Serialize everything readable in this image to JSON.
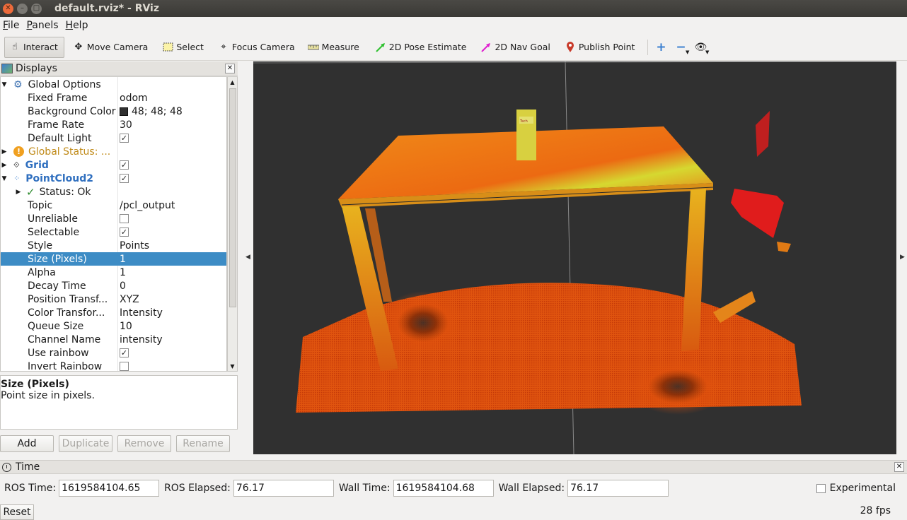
{
  "window": {
    "title": "default.rviz* - RViz"
  },
  "menu": [
    {
      "label": "File",
      "key": "F",
      "rest": "ile"
    },
    {
      "label": "Panels",
      "key": "P",
      "rest": "anels"
    },
    {
      "label": "Help",
      "key": "H",
      "rest": "elp"
    }
  ],
  "toolbar": {
    "interact": "Interact",
    "move_camera": "Move Camera",
    "select": "Select",
    "focus_camera": "Focus Camera",
    "measure": "Measure",
    "pose_estimate": "2D Pose Estimate",
    "nav_goal": "2D Nav Goal",
    "publish_point": "Publish Point"
  },
  "displays": {
    "title": "Displays",
    "rows": [
      {
        "name": "Global Options",
        "value": ""
      },
      {
        "name": "Fixed Frame",
        "value": "odom"
      },
      {
        "name": "Background Color",
        "value": "48; 48; 48"
      },
      {
        "name": "Frame Rate",
        "value": "30"
      },
      {
        "name": "Default Light",
        "value": ""
      },
      {
        "name": "Global Status: ...",
        "value": ""
      },
      {
        "name": "Grid",
        "value": ""
      },
      {
        "name": "PointCloud2",
        "value": ""
      },
      {
        "name": "Status: Ok",
        "value": ""
      },
      {
        "name": "Topic",
        "value": "/pcl_output"
      },
      {
        "name": "Unreliable",
        "value": ""
      },
      {
        "name": "Selectable",
        "value": ""
      },
      {
        "name": "Style",
        "value": "Points"
      },
      {
        "name": "Size (Pixels)",
        "value": "1"
      },
      {
        "name": "Alpha",
        "value": "1"
      },
      {
        "name": "Decay Time",
        "value": "0"
      },
      {
        "name": "Position Transf...",
        "value": "XYZ"
      },
      {
        "name": "Color Transfor...",
        "value": "Intensity"
      },
      {
        "name": "Queue Size",
        "value": "10"
      },
      {
        "name": "Channel Name",
        "value": "intensity"
      },
      {
        "name": "Use rainbow",
        "value": ""
      },
      {
        "name": "Invert Rainbow",
        "value": ""
      }
    ],
    "checks": {
      "default_light": true,
      "grid": true,
      "pointcloud2": true,
      "unreliable": false,
      "selectable": true,
      "use_rainbow": true,
      "invert_rainbow": false
    },
    "background_color_hex": "#303030",
    "description": {
      "title": "Size (Pixels)",
      "text": "Point size in pixels."
    },
    "buttons": {
      "add": "Add",
      "duplicate": "Duplicate",
      "remove": "Remove",
      "rename": "Rename"
    }
  },
  "time": {
    "title": "Time",
    "ros_time_label": "ROS Time:",
    "ros_time": "1619584104.65",
    "ros_elapsed_label": "ROS Elapsed:",
    "ros_elapsed": "76.17",
    "wall_time_label": "Wall Time:",
    "wall_time": "1619584104.68",
    "wall_elapsed_label": "Wall Elapsed:",
    "wall_elapsed": "76.17",
    "experimental_label": "Experimental",
    "experimental": false,
    "reset": "Reset",
    "fps": "28 fps"
  },
  "box_label": "Tsch"
}
